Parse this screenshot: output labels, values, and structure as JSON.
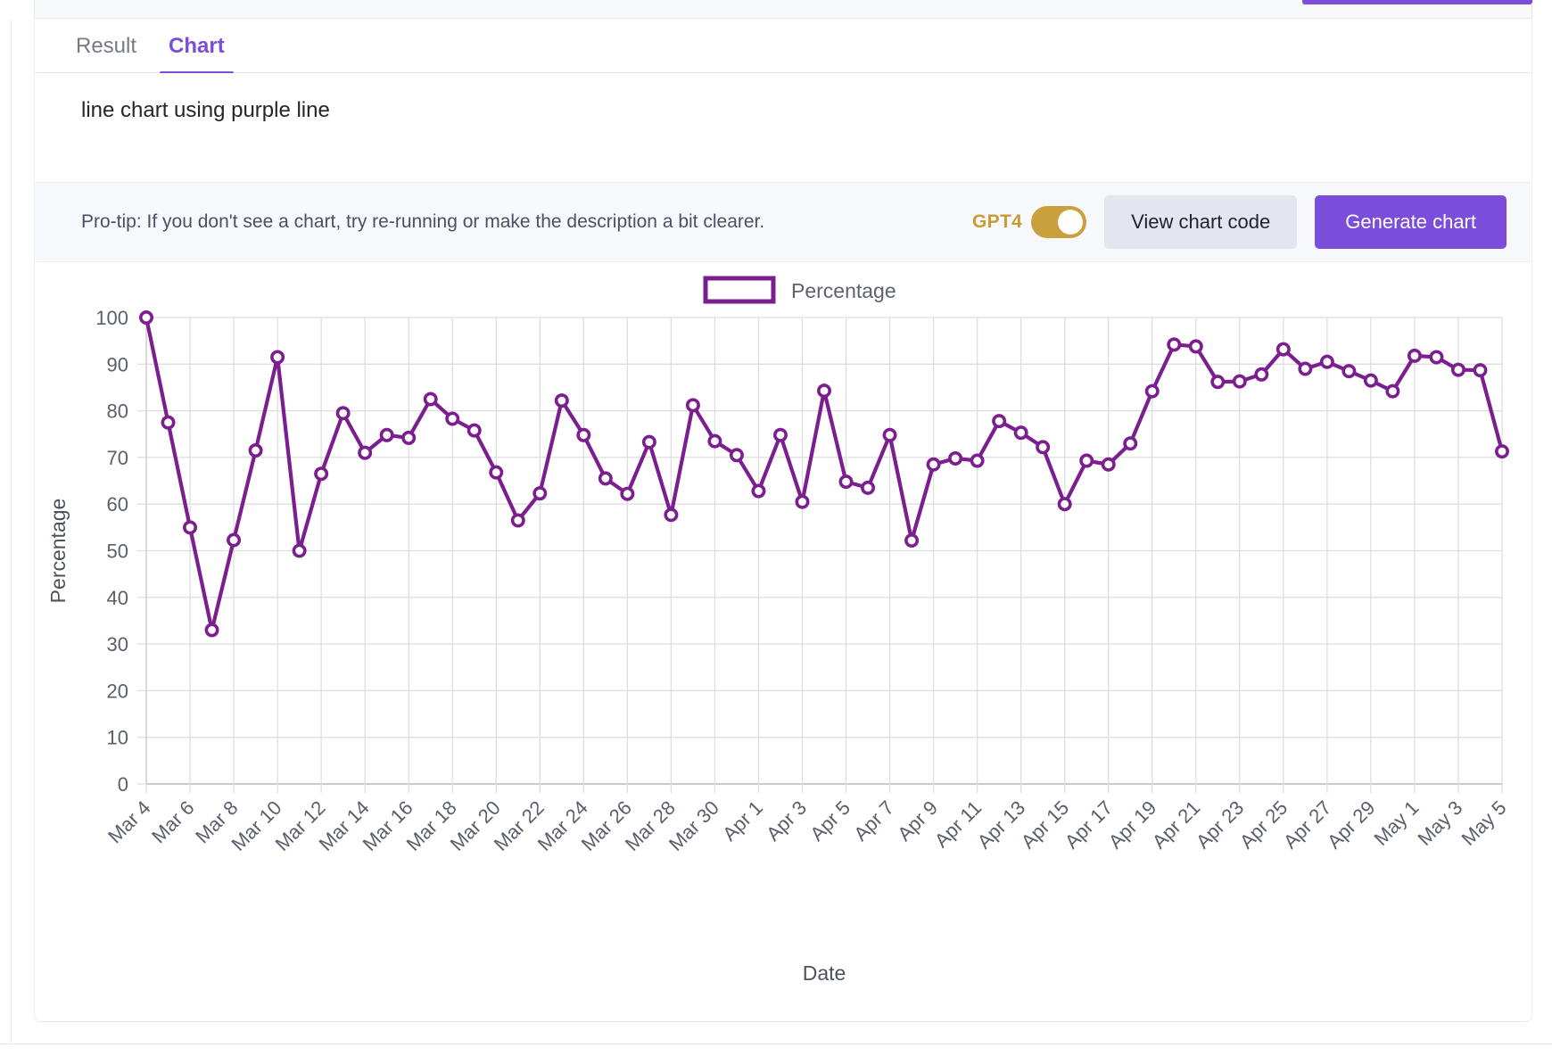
{
  "tabs": [
    {
      "label": "Result",
      "active": false
    },
    {
      "label": "Chart",
      "active": true
    }
  ],
  "description": "line chart using purple line",
  "protip": {
    "text": "Pro-tip: If you don't see a chart, try re-running or make the description a bit clearer.",
    "toggle_label": "GPT4",
    "toggle_on": true,
    "view_code_label": "View chart code",
    "generate_label": "Generate chart"
  },
  "colors": {
    "accent_purple": "#7c4ddb",
    "line_purple": "#7b1f8f",
    "toggle_gold": "#c9a03c",
    "secondary_button": "#e3e6ee",
    "grid": "#dedede"
  },
  "chart_data": {
    "type": "line",
    "title": "",
    "xlabel": "Date",
    "ylabel": "Percentage",
    "ylim": [
      0,
      100
    ],
    "yticks": [
      0,
      10,
      20,
      30,
      40,
      50,
      60,
      70,
      80,
      90,
      100
    ],
    "grid": true,
    "legend": {
      "position": "top-center",
      "entries": [
        "Percentage"
      ]
    },
    "series": [
      {
        "name": "Percentage",
        "color": "#7b1f8f",
        "marker": "circle-open",
        "values": [
          100.0,
          77.5,
          55.0,
          33.0,
          52.3,
          71.5,
          91.5,
          50.0,
          66.5,
          79.5,
          71.0,
          74.8,
          74.2,
          82.5,
          78.3,
          75.8,
          66.8,
          56.5,
          62.3,
          82.2,
          74.8,
          65.5,
          62.2,
          73.3,
          57.7,
          81.2,
          73.5,
          70.5,
          62.8,
          74.8,
          60.5,
          84.3,
          64.8,
          63.5,
          74.8,
          52.2,
          68.5,
          69.8,
          69.3,
          77.8,
          75.3,
          72.2,
          60.0,
          69.3,
          68.5,
          73.0,
          84.2,
          94.2,
          93.8,
          86.2,
          86.3,
          87.8,
          93.2,
          89.0,
          90.5,
          88.5,
          86.5,
          84.2,
          91.8,
          91.5,
          88.8,
          88.7,
          71.3
        ]
      }
    ],
    "x": [
      "Mar 4",
      "Mar 5",
      "Mar 6",
      "Mar 7",
      "Mar 8",
      "Mar 9",
      "Mar 10",
      "Mar 11",
      "Mar 12",
      "Mar 13",
      "Mar 14",
      "Mar 15",
      "Mar 16",
      "Mar 17",
      "Mar 18",
      "Mar 19",
      "Mar 20",
      "Mar 21",
      "Mar 22",
      "Mar 23",
      "Mar 24",
      "Mar 25",
      "Mar 26",
      "Mar 27",
      "Mar 28",
      "Mar 29",
      "Mar 30",
      "Mar 31",
      "Apr 1",
      "Apr 2",
      "Apr 3",
      "Apr 4",
      "Apr 5",
      "Apr 6",
      "Apr 7",
      "Apr 8",
      "Apr 9",
      "Apr 10",
      "Apr 11",
      "Apr 12",
      "Apr 13",
      "Apr 14",
      "Apr 15",
      "Apr 16",
      "Apr 17",
      "Apr 18",
      "Apr 19",
      "Apr 20",
      "Apr 21",
      "Apr 22",
      "Apr 23",
      "Apr 24",
      "Apr 25",
      "Apr 26",
      "Apr 27",
      "Apr 28",
      "Apr 29",
      "Apr 30",
      "May 1",
      "May 2",
      "May 3",
      "May 4",
      "May 5"
    ],
    "xtick_labels": [
      "Mar 4",
      "Mar 6",
      "Mar 8",
      "Mar 10",
      "Mar 12",
      "Mar 14",
      "Mar 16",
      "Mar 18",
      "Mar 20",
      "Mar 22",
      "Mar 24",
      "Mar 26",
      "Mar 28",
      "Mar 30",
      "Apr 1",
      "Apr 3",
      "Apr 5",
      "Apr 7",
      "Apr 9",
      "Apr 11",
      "Apr 13",
      "Apr 15",
      "Apr 17",
      "Apr 19",
      "Apr 21",
      "Apr 23",
      "Apr 25",
      "Apr 27",
      "Apr 29",
      "May 1",
      "May 3",
      "May 5"
    ]
  }
}
